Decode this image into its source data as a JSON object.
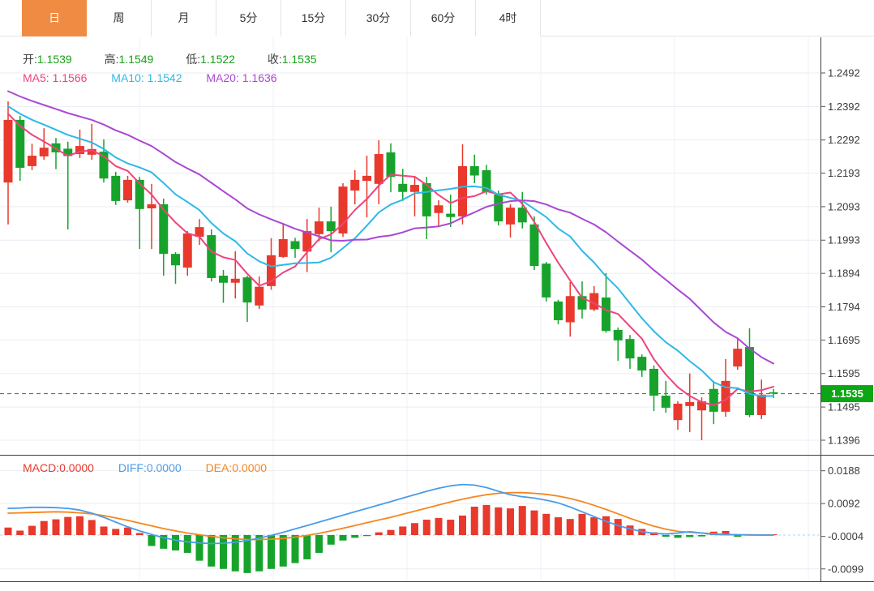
{
  "tabs": {
    "items": [
      {
        "label": "日",
        "name": "tab-day",
        "active": true
      },
      {
        "label": "周",
        "name": "tab-week",
        "active": false
      },
      {
        "label": "月",
        "name": "tab-month",
        "active": false
      },
      {
        "label": "5分",
        "name": "tab-5min",
        "active": false
      },
      {
        "label": "15分",
        "name": "tab-15min",
        "active": false
      },
      {
        "label": "30分",
        "name": "tab-30min",
        "active": false
      },
      {
        "label": "60分",
        "name": "tab-60min",
        "active": false
      },
      {
        "label": "4时",
        "name": "tab-4hour",
        "active": false
      }
    ]
  },
  "ohlc_bar": {
    "open_label": "开:",
    "open": "1.1539",
    "high_label": "高:",
    "high": "1.1549",
    "low_label": "低:",
    "low": "1.1522",
    "close_label": "收:",
    "close": "1.1535"
  },
  "ma_bar": {
    "ma5_label": "MA5:",
    "ma5": "1.1566",
    "ma10_label": "MA10:",
    "ma10": "1.1542",
    "ma20_label": "MA20:",
    "ma20": "1.1636"
  },
  "macd_bar": {
    "macd_label": "MACD:",
    "macd": "0.0000",
    "diff_label": "DIFF:",
    "diff": "0.0000",
    "dea_label": "DEA:",
    "dea": "0.0000"
  },
  "price_axis": {
    "labels": [
      "1.2492",
      "1.2392",
      "1.2292",
      "1.2193",
      "1.2093",
      "1.1993",
      "1.1894",
      "1.1794",
      "1.1695",
      "1.1595",
      "1.1495",
      "1.1396"
    ],
    "last_price_label": "1.1535"
  },
  "macd_axis": {
    "labels": [
      "0.0188",
      "0.0092",
      "-0.0004",
      "-0.0099"
    ]
  },
  "colors": {
    "up": "#e8392c",
    "down": "#17a32b",
    "badge": "#0ca614",
    "last_price_line": "#1fa32b",
    "ma5": "#f0437c",
    "ma10": "#2eb8e8",
    "ma20": "#aa48d2",
    "diff": "#4a9ce8",
    "dea": "#f5861f",
    "zero_line": "#a8d8f0",
    "grid": "#e9eef4",
    "vgrid": "#eef2f7",
    "axis": "#3f3f3f",
    "tab_active": "#ef8b43"
  },
  "chart_data": {
    "type": "candlestick",
    "convention": "red-up-green-down",
    "panes": [
      {
        "name": "price",
        "candle_order": [
          "open",
          "high",
          "low",
          "close"
        ],
        "candles": [
          [
            1.2165,
            1.2407,
            1.204,
            1.2352
          ],
          [
            1.2352,
            1.2364,
            1.217,
            1.2209
          ],
          [
            1.2214,
            1.2281,
            1.2202,
            1.2245
          ],
          [
            1.2243,
            1.2327,
            1.2233,
            1.2269
          ],
          [
            1.2282,
            1.2298,
            1.2205,
            1.2255
          ],
          [
            1.2266,
            1.2287,
            1.2025,
            1.2244
          ],
          [
            1.225,
            1.2323,
            1.2238,
            1.2274
          ],
          [
            1.2248,
            1.234,
            1.2233,
            1.2265
          ],
          [
            1.2257,
            1.2294,
            1.2165,
            1.2177
          ],
          [
            1.2185,
            1.2197,
            1.2098,
            1.211
          ],
          [
            1.2112,
            1.2185,
            1.2105,
            1.2173
          ],
          [
            1.2173,
            1.2182,
            1.1967,
            1.2086
          ],
          [
            1.2088,
            1.2161,
            1.1967,
            1.21
          ],
          [
            1.21,
            1.2117,
            1.1887,
            1.1952
          ],
          [
            1.1952,
            1.1957,
            1.1863,
            1.1918
          ],
          [
            1.1911,
            1.202,
            1.1887,
            1.2013
          ],
          [
            1.2003,
            1.2056,
            1.1979,
            1.2032
          ],
          [
            1.2008,
            1.2025,
            1.187,
            1.188
          ],
          [
            1.1887,
            1.1904,
            1.1806,
            1.1866
          ],
          [
            1.1866,
            1.196,
            1.1819,
            1.1878
          ],
          [
            1.1882,
            1.1887,
            1.1749,
            1.1807
          ],
          [
            1.1798,
            1.1885,
            1.1788,
            1.1854
          ],
          [
            1.1856,
            1.1999,
            1.1845,
            1.1948
          ],
          [
            1.1943,
            1.2044,
            1.194,
            1.1996
          ],
          [
            1.199,
            1.2,
            1.194,
            1.1967
          ],
          [
            1.1959,
            1.2056,
            1.1898,
            1.202
          ],
          [
            1.2011,
            1.209,
            1.199,
            1.2049
          ],
          [
            1.2049,
            1.2093,
            1.1957,
            1.202
          ],
          [
            1.2013,
            1.2163,
            1.2003,
            1.2153
          ],
          [
            1.2141,
            1.2202,
            1.21,
            1.2173
          ],
          [
            1.217,
            1.2245,
            1.2061,
            1.2185
          ],
          [
            1.2161,
            1.2291,
            1.21,
            1.225
          ],
          [
            1.2255,
            1.2282,
            1.2136,
            1.2182
          ],
          [
            1.2161,
            1.2206,
            1.211,
            1.2137
          ],
          [
            1.2137,
            1.2182,
            1.2064,
            1.2158
          ],
          [
            1.2163,
            1.2182,
            1.1996,
            1.2064
          ],
          [
            1.2074,
            1.2112,
            1.2032,
            1.2097
          ],
          [
            1.2072,
            1.2129,
            1.2032,
            1.2062
          ],
          [
            1.2064,
            1.2279,
            1.204,
            1.2214
          ],
          [
            1.2214,
            1.2248,
            1.2163,
            1.2186
          ],
          [
            1.2202,
            1.2218,
            1.2129,
            1.2137
          ],
          [
            1.2129,
            1.2141,
            1.2037,
            1.2049
          ],
          [
            1.204,
            1.21,
            1.2001,
            1.209
          ],
          [
            1.209,
            1.2137,
            1.2028,
            1.2046
          ],
          [
            1.204,
            1.2064,
            1.1904,
            1.1916
          ],
          [
            1.1923,
            1.1928,
            1.181,
            1.1822
          ],
          [
            1.181,
            1.1815,
            1.1742,
            1.1754
          ],
          [
            1.1748,
            1.1868,
            1.1705,
            1.1826
          ],
          [
            1.1826,
            1.187,
            1.1759,
            1.1786
          ],
          [
            1.1786,
            1.1856,
            1.1781,
            1.1835
          ],
          [
            1.1822,
            1.1895,
            1.1717,
            1.1722
          ],
          [
            1.1725,
            1.1732,
            1.1633,
            1.1694
          ],
          [
            1.1698,
            1.171,
            1.1609,
            1.164
          ],
          [
            1.1645,
            1.1652,
            1.1585,
            1.1604
          ],
          [
            1.1609,
            1.1619,
            1.1483,
            1.1529
          ],
          [
            1.1529,
            1.1573,
            1.1478,
            1.1493
          ],
          [
            1.1456,
            1.1512,
            1.1427,
            1.1505
          ],
          [
            1.1498,
            1.1595,
            1.142,
            1.151
          ],
          [
            1.1485,
            1.1524,
            1.1396,
            1.1512
          ],
          [
            1.1549,
            1.1573,
            1.1444,
            1.1481
          ],
          [
            1.1481,
            1.1638,
            1.1466,
            1.1573
          ],
          [
            1.1616,
            1.1698,
            1.1606,
            1.1669
          ],
          [
            1.1674,
            1.173,
            1.1465,
            1.1471
          ],
          [
            1.1471,
            1.1577,
            1.1459,
            1.1532
          ],
          [
            1.1539,
            1.1549,
            1.1522,
            1.1535
          ]
        ],
        "ma_periods": [
          5,
          10,
          20
        ],
        "ma_values_shown": {
          "MA5": 1.1566,
          "MA10": 1.1542,
          "MA20": 1.1636
        },
        "y_ticks": [
          1.2492,
          1.2392,
          1.2292,
          1.2193,
          1.2093,
          1.1993,
          1.1894,
          1.1794,
          1.1695,
          1.1595,
          1.1495,
          1.1396
        ],
        "last_price": 1.1535
      },
      {
        "name": "macd",
        "y_ticks": [
          0.0188,
          0.0092,
          -0.0004,
          -0.0099
        ],
        "histogram": [
          0.0022,
          0.0013,
          0.0027,
          0.0041,
          0.0046,
          0.0053,
          0.0055,
          0.0044,
          0.0025,
          0.0018,
          0.0022,
          0.0006,
          -0.0032,
          -0.004,
          -0.0045,
          -0.0052,
          -0.0075,
          -0.0092,
          -0.0099,
          -0.0106,
          -0.0111,
          -0.0106,
          -0.0099,
          -0.0092,
          -0.0082,
          -0.0071,
          -0.0052,
          -0.0028,
          -0.0016,
          -0.0008,
          -0.0003,
          0.0008,
          0.0015,
          0.0025,
          0.0035,
          0.0045,
          0.005,
          0.0045,
          0.0057,
          0.0083,
          0.0088,
          0.0081,
          0.0078,
          0.0085,
          0.0072,
          0.0062,
          0.0052,
          0.0047,
          0.0062,
          0.0052,
          0.0055,
          0.0047,
          0.0028,
          0.0018,
          0.0008,
          -0.0005,
          -0.0008,
          -0.0006,
          -0.0004,
          0.001,
          0.0012,
          -0.0005,
          0.0002,
          0.0001,
          0.0
        ],
        "diff": [
          0.0078,
          0.0079,
          0.0081,
          0.0081,
          0.008,
          0.0078,
          0.0073,
          0.0064,
          0.0052,
          0.0038,
          0.0024,
          0.0012,
          0.0002,
          -0.0008,
          -0.0015,
          -0.002,
          -0.0023,
          -0.0025,
          -0.0024,
          -0.0021,
          -0.0016,
          -0.0009,
          -0.0001,
          0.0008,
          0.0018,
          0.0028,
          0.0038,
          0.0048,
          0.0058,
          0.0068,
          0.0078,
          0.0088,
          0.0098,
          0.0108,
          0.0118,
          0.0128,
          0.0137,
          0.0144,
          0.0148,
          0.0146,
          0.0139,
          0.0128,
          0.0118,
          0.0112,
          0.0108,
          0.0102,
          0.0094,
          0.0082,
          0.0068,
          0.0054,
          0.004,
          0.0028,
          0.0018,
          0.001,
          0.0005,
          0.0003,
          0.0006,
          0.001,
          0.0006,
          0.0002,
          0.0001,
          0.0001,
          0.0,
          0.0,
          0.0
        ],
        "dea": [
          0.0064,
          0.0065,
          0.0066,
          0.0067,
          0.0068,
          0.0067,
          0.0065,
          0.0062,
          0.0057,
          0.005,
          0.0043,
          0.0035,
          0.0027,
          0.0019,
          0.0012,
          0.0006,
          0.0001,
          -0.0004,
          -0.0008,
          -0.0011,
          -0.0013,
          -0.0013,
          -0.0012,
          -0.001,
          -0.0006,
          -0.0001,
          0.0005,
          0.0012,
          0.002,
          0.0028,
          0.0036,
          0.0044,
          0.0052,
          0.0061,
          0.007,
          0.0079,
          0.0088,
          0.0097,
          0.0105,
          0.0112,
          0.0118,
          0.0122,
          0.0124,
          0.0124,
          0.0122,
          0.0119,
          0.0114,
          0.0107,
          0.0098,
          0.0087,
          0.0075,
          0.0062,
          0.0049,
          0.0037,
          0.0026,
          0.0017,
          0.0011,
          0.0008,
          0.0006,
          0.0004,
          0.0002,
          0.0001,
          0.0001,
          0.0,
          0.0
        ]
      }
    ]
  }
}
